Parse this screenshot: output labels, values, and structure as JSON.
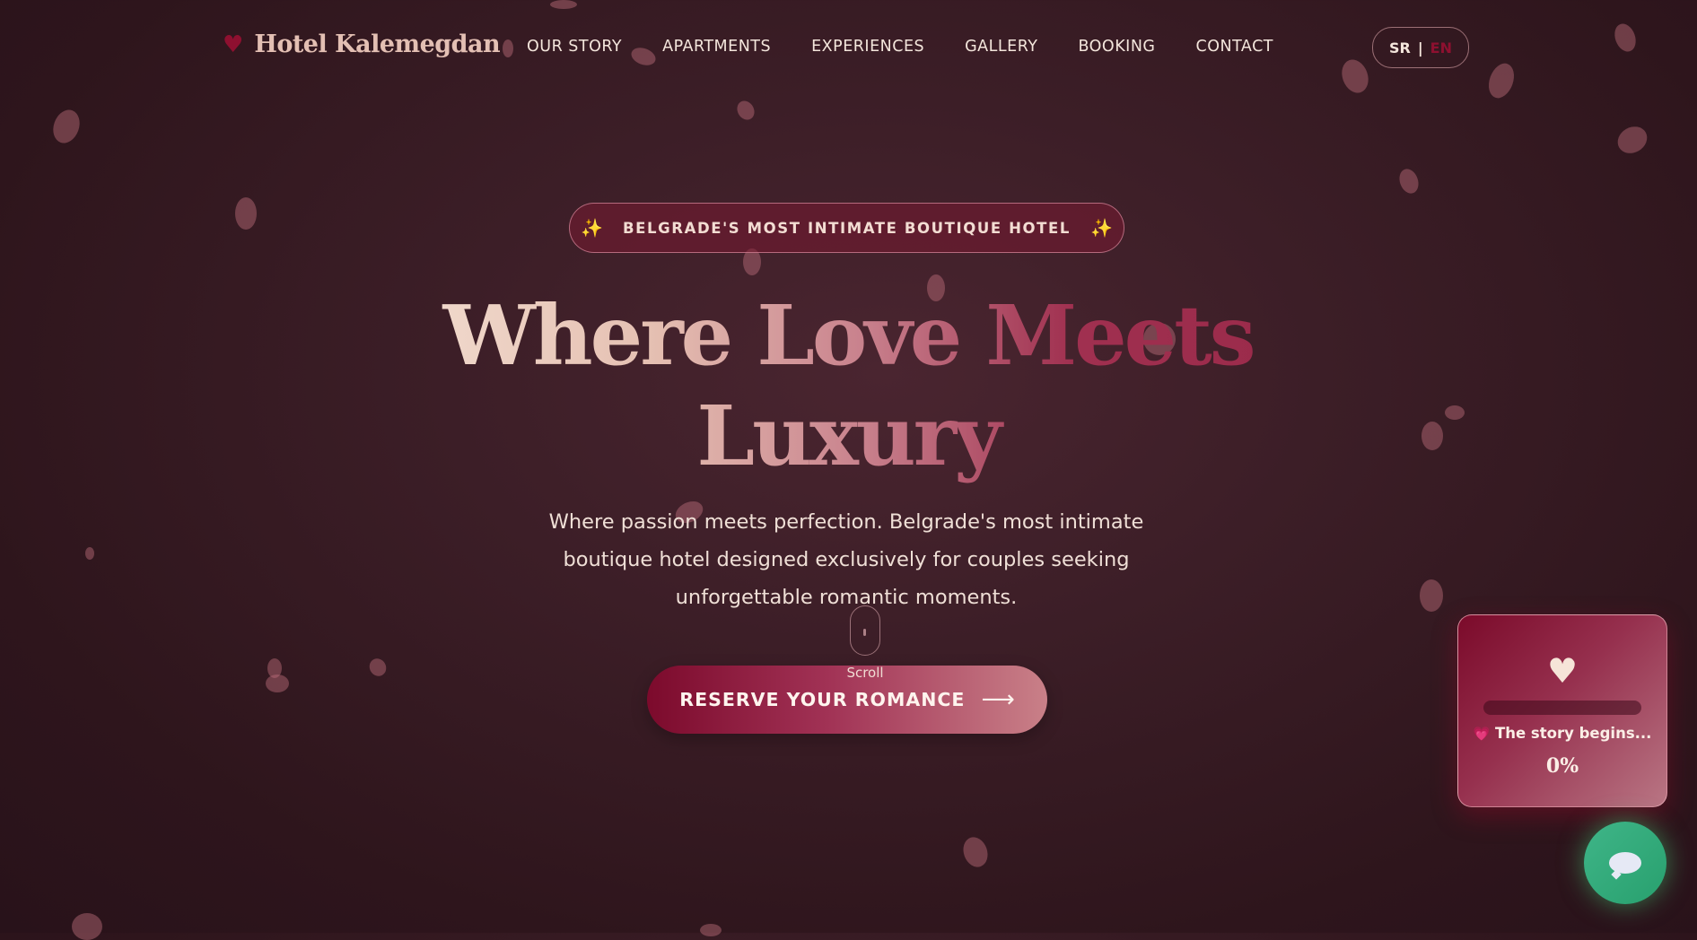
{
  "nav": {
    "logo_heart": "♥",
    "brand": "Hotel Kalemegdan",
    "items": [
      {
        "label": "OUR STORY"
      },
      {
        "label": "APARTMENTS"
      },
      {
        "label": "EXPERIENCES"
      },
      {
        "label": "GALLERY"
      },
      {
        "label": "BOOKING"
      },
      {
        "label": "CONTACT"
      }
    ],
    "lang": {
      "sr": "SR",
      "separator": "|",
      "en": "EN",
      "active": "EN"
    }
  },
  "hero": {
    "badge_icon": "✨",
    "badge": "BELGRADE'S MOST INTIMATE BOUTIQUE HOTEL",
    "headline_line1": "Where Love Meets",
    "headline_line2": "Luxury",
    "subtitle": "Where passion meets perfection. Belgrade's most intimate boutique hotel designed exclusively for couples seeking unforgettable romantic moments.",
    "scroll_label": "Scroll",
    "cta_label": "RESERVE YOUR ROMANCE",
    "cta_arrow": "⟶"
  },
  "story_card": {
    "heart": "♥",
    "status_icon": "💗",
    "status": "The story begins...",
    "progress_percent": "0%",
    "progress_value": 0
  },
  "chat": {
    "icon": "chat-bubble-icon"
  },
  "colors": {
    "accent": "#8e1030",
    "cta_gradient_start": "#7c0a2c",
    "cta_gradient_end": "#c98088",
    "chat_green": "#3fb588",
    "background": "#3c1e27"
  }
}
